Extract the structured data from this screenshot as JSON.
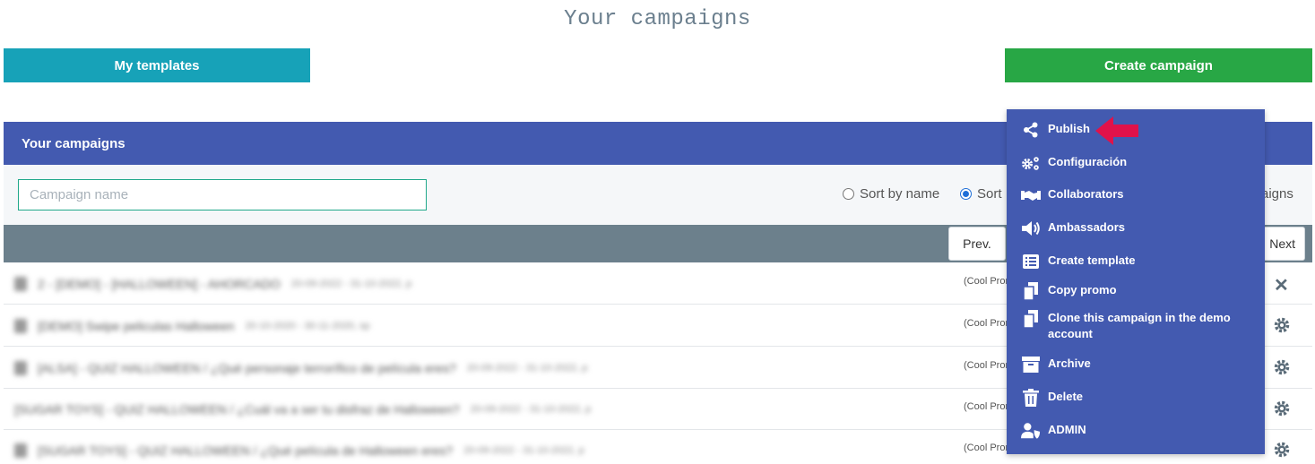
{
  "page": {
    "title": "Your campaigns"
  },
  "toolbar": {
    "templates_label": "My templates",
    "create_label": "Create campaign"
  },
  "panel": {
    "header": "Your campaigns"
  },
  "filters": {
    "search_placeholder": "Campaign name",
    "search_value": "",
    "sort_name_label": "Sort by name",
    "sort_other_label": "Sort",
    "sort_selected": "other",
    "tail_text": "aigns"
  },
  "pager": {
    "prev_label": "Prev.",
    "next_label": "Next"
  },
  "rows": [
    {
      "name": "2 - [DEMO] - [HALLOWEEN] - AHORCADO",
      "dates": "20-09-2022 - 31-10-2022, p",
      "type": "(Cool Prom",
      "action": "close"
    },
    {
      "name": "[DEMO] Swipe peliculas Halloween",
      "dates": "20-10-2020 - 30-11-2020, sp",
      "type": "(Cool Prom",
      "action": "gear"
    },
    {
      "name": "[ALSA] - QUIZ HALLOWEEN / ¿Qué personaje terrorífico de película eres?",
      "dates": "20-09-2022 - 31-10-2022, p",
      "type": "(Cool Prom",
      "action": "gear"
    },
    {
      "name": "[SUGAR TOYS] - QUIZ HALLOWEEN / ¿Cuál va a ser tu disfraz de Halloween?",
      "dates": "20-09-2022 - 31-10-2022, p",
      "type": "(Cool Prom",
      "action": "gear"
    },
    {
      "name": "[SUGAR TOYS] - QUIZ HALLOWEEN / ¿Qué película de Halloween eres?",
      "dates": "20-09-2022 - 31-10-2022, p",
      "type": "(Cool Prom",
      "action": "gear"
    }
  ],
  "context_menu": {
    "items": [
      {
        "label": "Publish",
        "icon": "share-icon"
      },
      {
        "label": "Configuración",
        "icon": "gears-icon"
      },
      {
        "label": "Collaborators",
        "icon": "handshake-icon"
      },
      {
        "label": "Ambassadors",
        "icon": "megaphone-icon"
      },
      {
        "label": "Create template",
        "icon": "list-icon"
      },
      {
        "label": "Copy promo",
        "icon": "copy-icon"
      },
      {
        "label": "Clone this campaign in the demo account",
        "icon": "clone-icon"
      },
      {
        "label": "Archive",
        "icon": "archive-icon"
      },
      {
        "label": "Delete",
        "icon": "trash-icon"
      },
      {
        "label": "ADMIN",
        "icon": "user-shield-icon"
      }
    ]
  },
  "colors": {
    "header": "#435ab0",
    "templates_button": "#17a2b8",
    "create_button": "#28a745",
    "annotation_arrow": "#e0124a"
  }
}
